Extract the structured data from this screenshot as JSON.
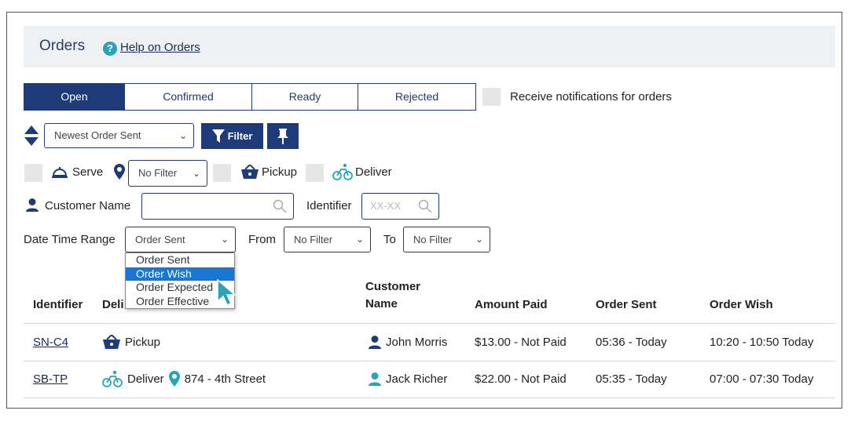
{
  "header": {
    "title": "Orders",
    "help_link": "Help on Orders"
  },
  "tabs": [
    {
      "label": "Open",
      "active": true
    },
    {
      "label": "Confirmed",
      "active": false
    },
    {
      "label": "Ready",
      "active": false
    },
    {
      "label": "Rejected",
      "active": false
    }
  ],
  "notifications_label": "Receive notifications for orders",
  "sort": {
    "selected": "Newest Order Sent"
  },
  "filter_button_label": "Filter",
  "delivery_filters": {
    "serve_label": "Serve",
    "location_filter": "No Filter",
    "pickup_label": "Pickup",
    "deliver_label": "Deliver"
  },
  "search": {
    "customer_name_label": "Customer Name",
    "customer_name_value": "",
    "identifier_label": "Identifier",
    "identifier_placeholder": "XX-XX"
  },
  "date_range": {
    "label": "Date Time Range",
    "selected": "Order Sent",
    "from_label": "From",
    "from_value": "No Filter",
    "to_label": "To",
    "to_value": "No Filter",
    "options": [
      "Order Sent",
      "Order Wish",
      "Order Expected",
      "Order Effective"
    ],
    "highlighted_option": "Order Wish"
  },
  "table": {
    "headers": {
      "identifier": "Identifier",
      "delivery": "Deli",
      "customer_line1": "Customer",
      "customer_line2": "Name",
      "amount": "Amount Paid",
      "order_sent": "Order Sent",
      "order_wish": "Order Wish"
    },
    "rows": [
      {
        "identifier": "SN-C4",
        "delivery": "Pickup",
        "address": "",
        "customer": "John Morris",
        "amount": "$13.00 - Not Paid",
        "order_sent": "05:36 - Today",
        "order_wish": "10:20 - 10:50 Today"
      },
      {
        "identifier": "SB-TP",
        "delivery": "Deliver",
        "address": "874 - 4th Street",
        "customer": "Jack Richer",
        "amount": "$22.00 - Not Paid",
        "order_sent": "05:35 - Today",
        "order_wish": "07:00 - 07:30 Today"
      }
    ]
  },
  "colors": {
    "primary": "#1e3a78",
    "accent": "#2aa3b8",
    "highlight": "#1976d2"
  }
}
